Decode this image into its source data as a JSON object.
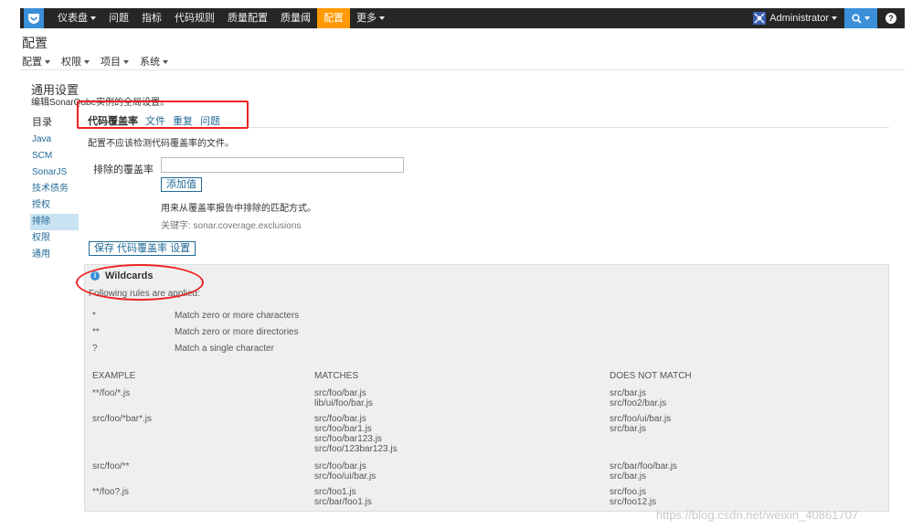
{
  "nav": {
    "items": [
      {
        "label": "仪表盘",
        "caret": true
      },
      {
        "label": "问题",
        "caret": false
      },
      {
        "label": "指标",
        "caret": false
      },
      {
        "label": "代码规则",
        "caret": false
      },
      {
        "label": "质量配置",
        "caret": false
      },
      {
        "label": "质量阈",
        "caret": false
      },
      {
        "label": "配置",
        "caret": false,
        "active": true
      },
      {
        "label": "更多",
        "caret": true
      }
    ],
    "user": "Administrator",
    "help": "?"
  },
  "page": {
    "title": "配置",
    "submenu": [
      "配置",
      "权限",
      "项目",
      "系统"
    ],
    "section_title": "通用设置",
    "section_desc": "编辑SonarQube实例的全局设置。"
  },
  "sidebar": {
    "head": "目录",
    "items": [
      "Java",
      "SCM",
      "SonarJS",
      "技术债务",
      "授权",
      "排除",
      "权限",
      "通用"
    ],
    "active_index": 5
  },
  "tabs": {
    "items": [
      "代码覆盖率",
      "文件",
      "重复",
      "问题"
    ],
    "active_index": 0
  },
  "form": {
    "desc": "配置不应该检测代码覆盖率的文件。",
    "label": "排除的覆盖率",
    "value": "",
    "add_button": "添加值",
    "help": "用来从覆盖率报告中排除的匹配方式。",
    "key": "关键字: sonar.coverage.exclusions",
    "save_button": "保存 代码覆盖率 设置"
  },
  "wildcards": {
    "title": "Wildcards",
    "subtitle": "Following rules are applied:",
    "rules": [
      {
        "symbol": "*",
        "desc": "Match zero or more characters"
      },
      {
        "symbol": "**",
        "desc": "Match zero or more directories"
      },
      {
        "symbol": "?",
        "desc": "Match a single character"
      }
    ],
    "headers": [
      "EXAMPLE",
      "MATCHES",
      "DOES NOT MATCH"
    ],
    "examples": [
      {
        "example": "**/foo/*.js",
        "matches": [
          "src/foo/bar.js",
          "lib/ui/foo/bar.js"
        ],
        "not_match": [
          "src/bar.js",
          "src/foo2/bar.js"
        ]
      },
      {
        "example": "src/foo/*bar*.js",
        "matches": [
          "src/foo/bar.js",
          "src/foo/bar1.js",
          "src/foo/bar123.js",
          "src/foo/123bar123.js"
        ],
        "not_match": [
          "src/foo/ui/bar.js",
          "src/bar.js"
        ]
      },
      {
        "example": "src/foo/**",
        "matches": [
          "src/foo/bar.js",
          "src/foo/ui/bar.js"
        ],
        "not_match": [
          "src/bar/foo/bar.js",
          "src/bar.js"
        ]
      },
      {
        "example": "**/foo?.js",
        "matches": [
          "src/foo1.js",
          "src/bar/foo1.js"
        ],
        "not_match": [
          "src/foo.js",
          "src/foo12.js"
        ]
      }
    ]
  },
  "watermark": "https://blog.csdn.net/weixin_40861707",
  "colors": {
    "nav_bg": "#262626",
    "active": "#ff9900",
    "accent": "#3a8fd8",
    "link": "#236a97",
    "annotation": "#ee2222"
  }
}
